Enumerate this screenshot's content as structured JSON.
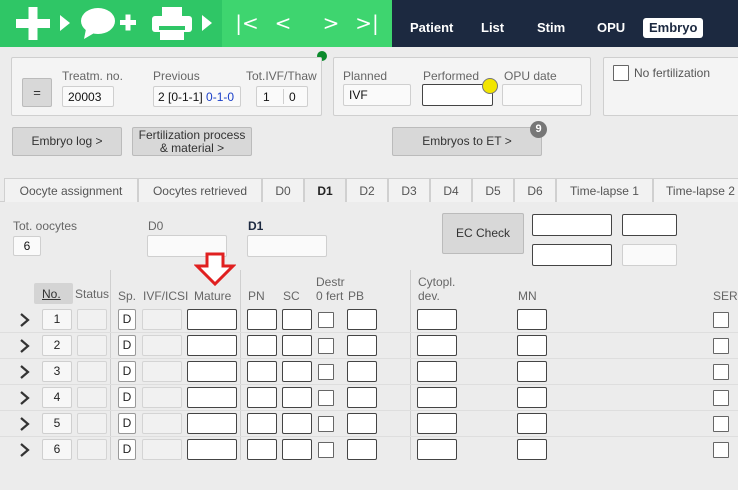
{
  "colors": {
    "topbar_dark": "#1c2940",
    "green": "#2fc666",
    "green_light": "#3ed56f",
    "indicator_green": "#0b8a2c",
    "indicator_yellow": "#f2e500",
    "arrow_red": "#e02020",
    "badge_grey": "#777777"
  },
  "topbar": {
    "tabs": [
      "Patient",
      "List",
      "Stim",
      "OPU",
      "Embryo"
    ],
    "active_tab": "Embryo",
    "nav": {
      "first": "|<",
      "prev": "<",
      "next": ">",
      "last": ">|"
    }
  },
  "treatment": {
    "equals_label": "=",
    "treatm_no_label": "Treatm. no.",
    "treatm_no_value": "20003",
    "previous_label": "Previous",
    "previous_value_main": "2 [0-1-1]",
    "previous_value_link": "0-1-0",
    "tot_label": "Tot.IVF/Thaw",
    "tot_ivf": "1",
    "tot_thaw": "0"
  },
  "procedure": {
    "planned_label": "Planned",
    "planned_value": "IVF",
    "performed_label": "Performed",
    "performed_value": "",
    "opu_date_label": "OPU date",
    "opu_date_value": ""
  },
  "no_fertilization_label": "No fertilization",
  "buttons": {
    "embryo_log": "Embryo log >",
    "fert_process_line1": "Fertilization process",
    "fert_process_line2": "& material >",
    "embryos_to_et": "Embryos to ET >",
    "embryos_to_et_badge": "9",
    "ec_check": "EC Check"
  },
  "day_tabs": [
    "Oocyte assignment",
    "Oocytes retrieved",
    "D0",
    "D1",
    "D2",
    "D3",
    "D4",
    "D5",
    "D6",
    "Time-lapse 1",
    "Time-lapse 2"
  ],
  "active_day_tab": "D1",
  "summary": {
    "tot_oocytes_label": "Tot. oocytes",
    "tot_oocytes_value": "6",
    "d0_label": "D0",
    "d1_label": "D1"
  },
  "columns": {
    "no": "No.",
    "status": "Status",
    "sp": "Sp.",
    "ivf_icsi": "IVF/ICSI",
    "mature": "Mature",
    "pn": "PN",
    "sc": "SC",
    "destr_line1": "Destr",
    "destr_line2": "0 fert",
    "pb": "PB",
    "cytopl_line1": "Cytopl.",
    "cytopl_line2": "dev.",
    "mn": "MN",
    "ser": "SER"
  },
  "rows": [
    {
      "no": "1",
      "sp": "D"
    },
    {
      "no": "2",
      "sp": "D"
    },
    {
      "no": "3",
      "sp": "D"
    },
    {
      "no": "4",
      "sp": "D"
    },
    {
      "no": "5",
      "sp": "D"
    },
    {
      "no": "6",
      "sp": "D"
    }
  ]
}
